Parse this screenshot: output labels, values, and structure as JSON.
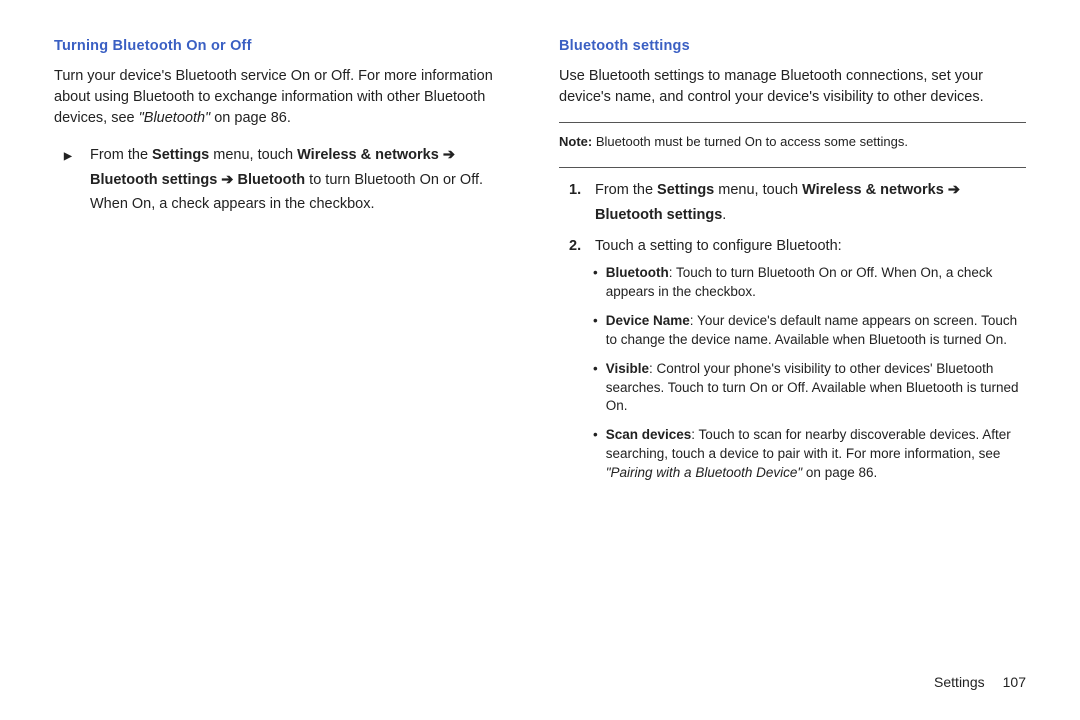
{
  "left": {
    "heading": "Turning Bluetooth On or Off",
    "para_a": "Turn your device's Bluetooth service On or Off. For more information about using Bluetooth to exchange information with other Bluetooth devices, see ",
    "para_ref": "\"Bluetooth\"",
    "para_suffix": " on page 86.",
    "step_marker": "▶",
    "step_a": "From the ",
    "step_b": "Settings",
    "step_c": " menu, touch ",
    "step_d": "Wireless & networks",
    "arrow": " ➔ ",
    "step_e": "Bluetooth settings",
    "arrow2": " ➔ ",
    "step_f": "Bluetooth",
    "step_g": " to turn Bluetooth On or Off. When On, a check appears in the checkbox."
  },
  "right": {
    "heading": "Bluetooth settings",
    "para": "Use Bluetooth settings to manage Bluetooth connections, set your device's name, and control your device's visibility to other devices.",
    "note_label": "Note:",
    "note_text": " Bluetooth must be turned On to access some settings.",
    "step1_marker": "1.",
    "step1_a": "From the ",
    "step1_b": "Settings",
    "step1_c": " menu, touch ",
    "step1_d": "Wireless & networks",
    "arrow": " ➔ ",
    "step1_e": "Bluetooth settings",
    "step1_f": ".",
    "step2_marker": "2.",
    "step2_text": "Touch a setting to configure Bluetooth:",
    "b1_label": "Bluetooth",
    "b1_text": ": Touch to turn Bluetooth On or Off. When On, a check appears in the checkbox.",
    "b2_label": "Device Name",
    "b2_text": ": Your device's default name appears on screen. Touch to change the device name. Available when Bluetooth is turned On.",
    "b3_label": "Visible",
    "b3_text": ": Control your phone's visibility to other devices' Bluetooth searches. Touch to turn On or Off. Available when Bluetooth is turned On.",
    "b4_label": "Scan devices",
    "b4_text_a": ": Touch to scan for nearby discoverable devices. After searching, touch a device to pair with it.  For more information, see ",
    "b4_ref": "\"Pairing with a Bluetooth Device\"",
    "b4_text_b": " on page 86."
  },
  "footer": {
    "section": "Settings",
    "page": "107"
  }
}
